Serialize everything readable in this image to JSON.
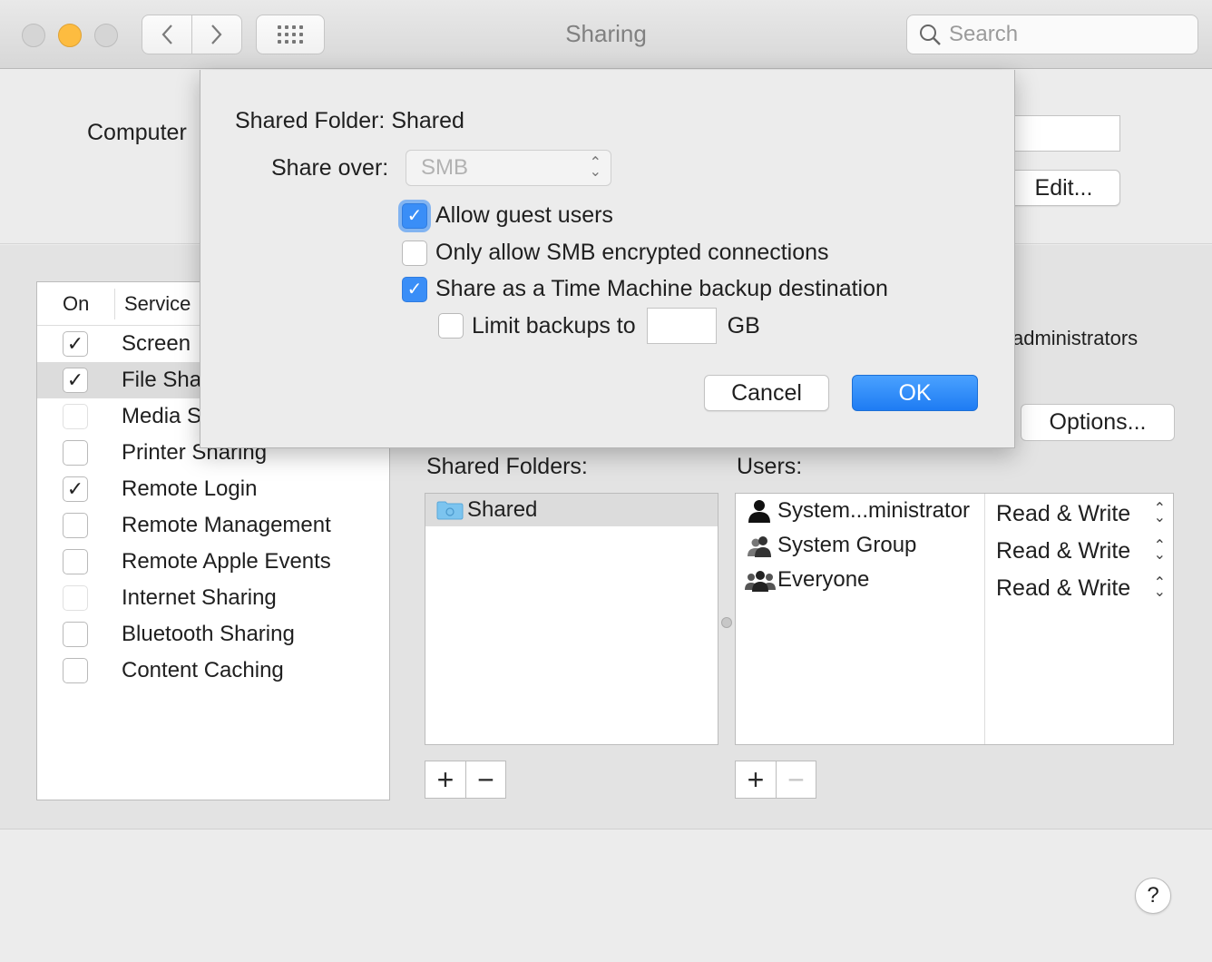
{
  "window": {
    "title": "Sharing",
    "search_placeholder": "Search",
    "nav_back": "‹",
    "nav_forward": "›"
  },
  "computer_name": {
    "label": "Computer",
    "edit_label": "Edit..."
  },
  "services": {
    "header_on": "On",
    "header_service": "Service",
    "items": [
      {
        "label": "Screen Sharing",
        "checked": true
      },
      {
        "label": "File Sharing",
        "checked": true,
        "selected": true
      },
      {
        "label": "Media Sharing",
        "checked": false
      },
      {
        "label": "Printer Sharing",
        "checked": false
      },
      {
        "label": "Remote Login",
        "checked": true
      },
      {
        "label": "Remote Management",
        "checked": false
      },
      {
        "label": "Remote Apple Events",
        "checked": false
      },
      {
        "label": "Internet Sharing",
        "checked": false
      },
      {
        "label": "Bluetooth Sharing",
        "checked": false
      },
      {
        "label": "Content Caching",
        "checked": false
      }
    ],
    "visible_labels": [
      "Screen",
      "File Sha",
      "Media S",
      "Printer Sharing",
      "Remote Login",
      "Remote Management",
      "Remote Apple Events",
      "Internet Sharing",
      "Bluetooth Sharing",
      "Content Caching"
    ]
  },
  "detail": {
    "admins_text": "administrators",
    "options_label": "Options...",
    "shared_folders_label": "Shared Folders:",
    "users_label": "Users:",
    "shared_folders": [
      "Shared"
    ],
    "users": [
      {
        "name": "System...ministrator",
        "icon": "person-icon",
        "permission": "Read & Write"
      },
      {
        "name": "System Group",
        "icon": "group-icon",
        "permission": "Read & Write"
      },
      {
        "name": "Everyone",
        "icon": "everyone-icon",
        "permission": "Read & Write"
      }
    ],
    "add_symbol": "+",
    "remove_symbol": "−"
  },
  "help": {
    "label": "?"
  },
  "sheet": {
    "title": "Shared Folder: Shared",
    "share_over_label": "Share over:",
    "share_over_value": "SMB",
    "allow_guest": {
      "label": "Allow guest users",
      "checked": true
    },
    "smb_encrypted": {
      "label": "Only allow SMB encrypted connections",
      "checked": false
    },
    "time_machine": {
      "label": "Share as a Time Machine backup destination",
      "checked": true
    },
    "limit_backups": {
      "label": "Limit backups to",
      "unit": "GB",
      "checked": false,
      "value": ""
    },
    "cancel_label": "Cancel",
    "ok_label": "OK"
  },
  "colors": {
    "accent": "#1e7cf3",
    "min_button": "#fdbc40"
  }
}
